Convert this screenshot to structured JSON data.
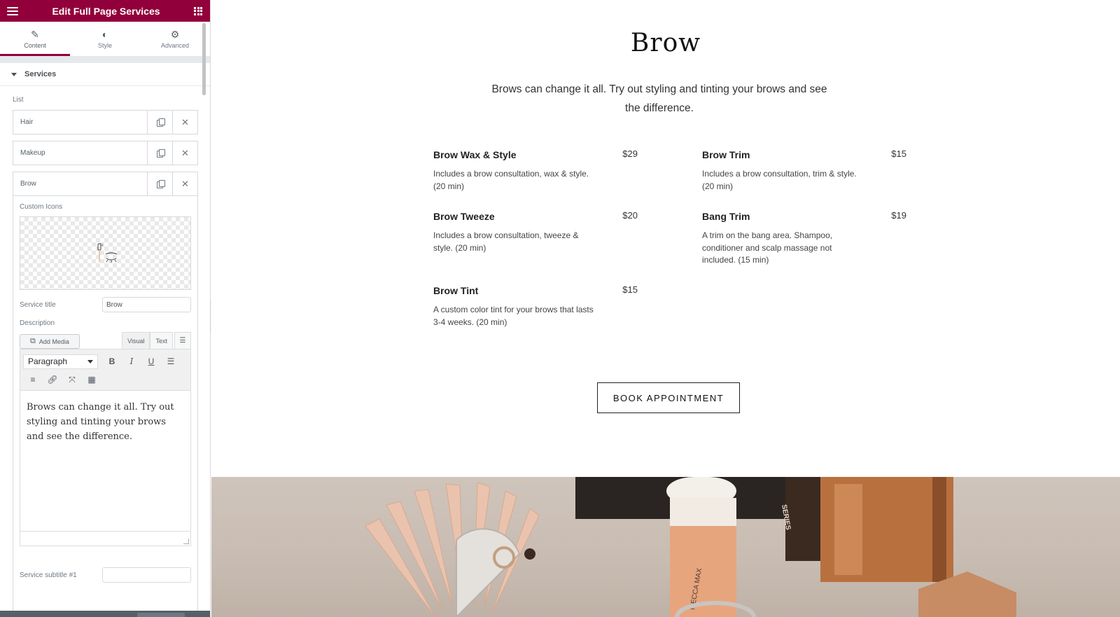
{
  "panel": {
    "title": "Edit Full Page Services",
    "tabs": [
      {
        "label": "Content",
        "icon": "pencil-icon"
      },
      {
        "label": "Style",
        "icon": "contrast-icon"
      },
      {
        "label": "Advanced",
        "icon": "gear-icon"
      }
    ],
    "section_title": "Services",
    "list_label": "List",
    "items": [
      {
        "label": "Hair"
      },
      {
        "label": "Makeup"
      },
      {
        "label": "Brow"
      }
    ],
    "open_item": {
      "custom_icons_label": "Custom Icons",
      "service_title_label": "Service title",
      "service_title_value": "Brow",
      "description_label": "Description",
      "add_media_label": "Add Media",
      "visual_tab": "Visual",
      "text_tab": "Text",
      "format_select": "Paragraph",
      "content": "Brows can change it all. Try out styling and tinting your brows and see the difference.",
      "subtitle_label": "Service subtitle #1"
    },
    "accent_color": "#92003b"
  },
  "preview": {
    "heading": "Brow",
    "intro": "Brows can change it all. Try out styling and tinting your brows and see the difference.",
    "services": [
      {
        "title": "Brow Wax & Style",
        "price": "$29",
        "desc": "Includes a brow consultation, wax & style. (20 min)"
      },
      {
        "title": "Brow Trim",
        "price": "$15",
        "desc": "Includes a brow consultation, trim & style. (20 min)"
      },
      {
        "title": "Brow Tweeze",
        "price": "$20",
        "desc": "Includes a brow consultation, tweeze & style. (20 min)"
      },
      {
        "title": "Bang Trim",
        "price": "$19",
        "desc": "A trim on the bang area. Shampoo, conditioner and scalp massage not included. (15 min)"
      },
      {
        "title": "Brow Tint",
        "price": "$15",
        "desc": "A custom color tint for your brows that lasts 3-4 weeks. (20 min)"
      }
    ],
    "button_label": "BOOK APPOINTMENT",
    "photo_text": [
      "SERIES",
      "MECCA MAX"
    ]
  }
}
